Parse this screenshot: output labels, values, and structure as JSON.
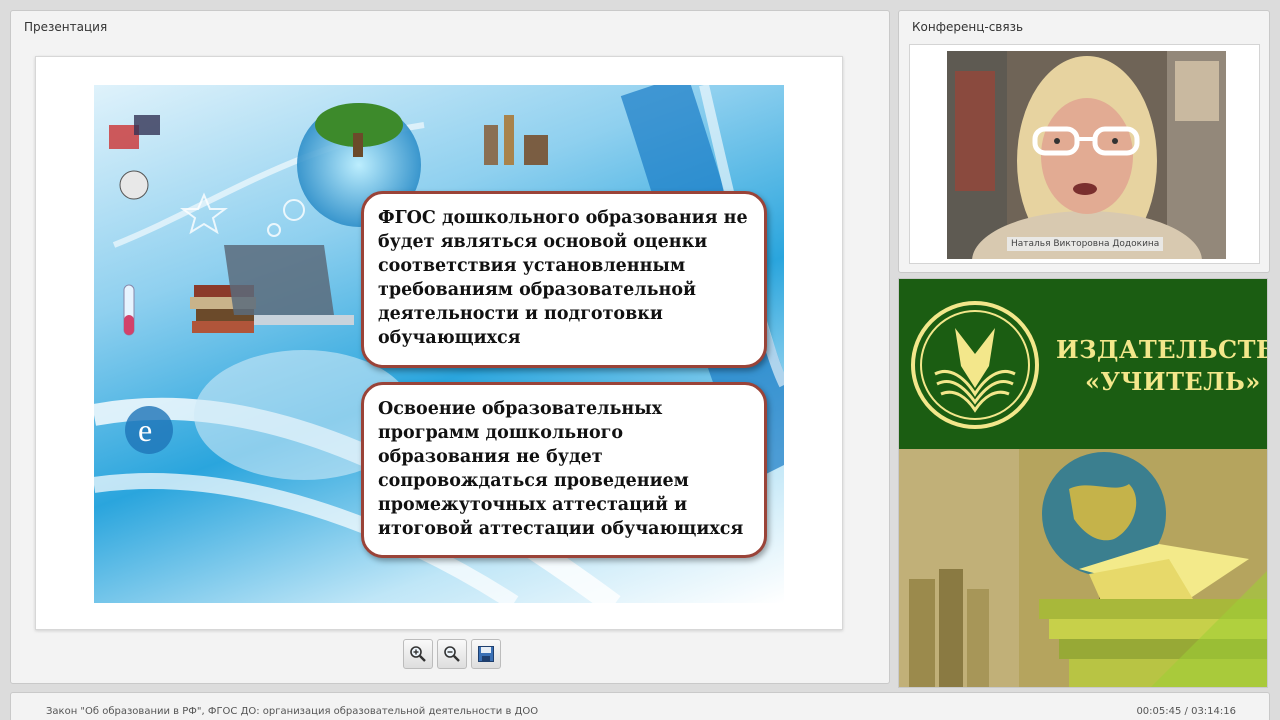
{
  "presentation": {
    "title": "Презентация",
    "slide": {
      "callout_1": "ФГОС дошкольного образования не будет являться основой оценки соответствия установленным требованиям образовательной деятельности и подготовки обучающихся",
      "callout_2": "Освоение образовательных программ дошкольного образования не будет сопровождаться проведением промежуточных аттестаций и итоговой аттестации обучающихся"
    },
    "toolbar": {
      "buttons": [
        "zoom-in-icon",
        "zoom-out-icon",
        "save-icon"
      ]
    }
  },
  "conference": {
    "title": "Конференц-связь",
    "speaker_name": "Наталья Викторовна Додокина"
  },
  "ad": {
    "line1": "ИЗДАТЕЛЬСТВО",
    "line2": "«УЧИТЕЛЬ»",
    "colors": {
      "background": "#1b5d12",
      "text": "#f3e78b"
    }
  },
  "status": {
    "lecture_title": "Закон \"Об образовании в РФ\", ФГОС ДО: организация образовательной деятельности в ДОО",
    "time": "00:05:45 / 03:14:16"
  }
}
